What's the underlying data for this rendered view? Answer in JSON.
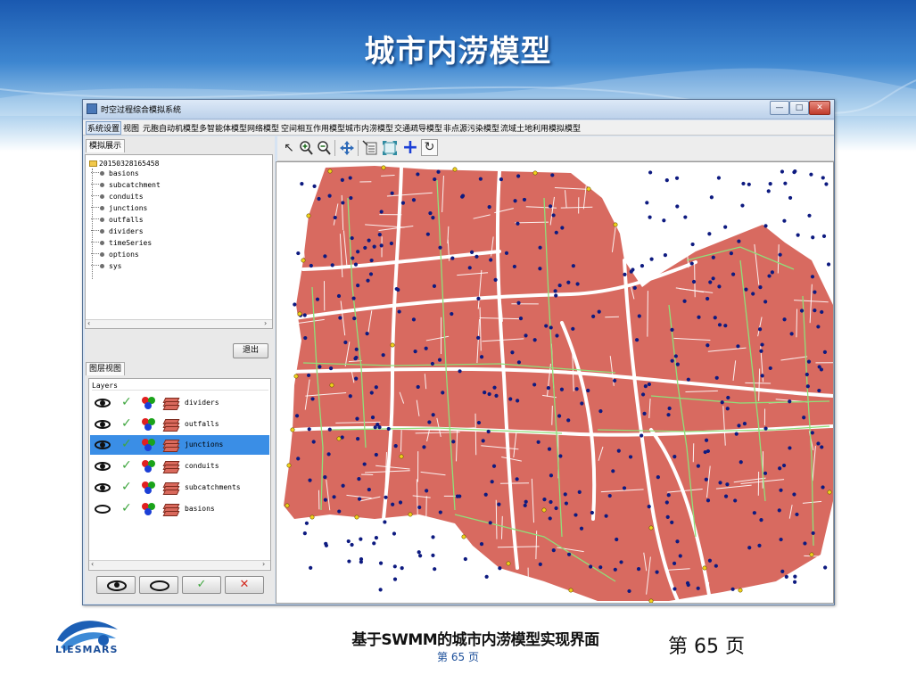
{
  "slide": {
    "title": "城市内涝模型",
    "caption": "基于SWMM的城市内涝模型实现界面",
    "page_small": "第  65 页",
    "page_big": "第 65 页",
    "logo_text": "LIESMARS",
    "colors": {
      "header_blue": "#1a59b0",
      "caption_blue": "#1c4f9a"
    }
  },
  "window": {
    "title": "时空过程综合模拟系统",
    "controls": {
      "minimize": "—",
      "maximize": "□",
      "close": "✕"
    }
  },
  "menu": [
    "系统设置",
    "视图",
    "元胞自动机模型",
    "多智能体模型",
    "网络模型",
    "空间相互作用模型",
    "城市内涝模型",
    "交通疏导模型",
    "非点源污染模型",
    "流域土地利用模拟模型"
  ],
  "left_panel": {
    "simulation_tab": "模拟展示",
    "tree": {
      "root": "20150328165458",
      "items": [
        "basions",
        "subcatchment",
        "conduits",
        "junctions",
        "outfalls",
        "dividers",
        "timeSeries",
        "options",
        "sys"
      ]
    },
    "exit_button": "退出",
    "layers_tab": "图层视图",
    "layers_header": "Layers",
    "layers": [
      {
        "name": "dividers",
        "visible": true,
        "selected": false
      },
      {
        "name": "outfalls",
        "visible": true,
        "selected": false
      },
      {
        "name": "junctions",
        "visible": true,
        "selected": true
      },
      {
        "name": "conduits",
        "visible": true,
        "selected": false
      },
      {
        "name": "subcatchments",
        "visible": true,
        "selected": false
      },
      {
        "name": "basions",
        "visible": false,
        "selected": false
      }
    ],
    "layer_buttons": [
      "show-all-icon",
      "hide-all-icon",
      "confirm-icon",
      "cancel-icon"
    ]
  },
  "map": {
    "toolbar": [
      "select-arrow-icon",
      "zoom-in-icon",
      "zoom-out-icon",
      "pan-icon",
      "layer-properties-icon",
      "full-extent-icon",
      "add-point-icon",
      "refresh-icon"
    ],
    "colors": {
      "subcatchment_fill": "#d86a60",
      "street": "#ffffff",
      "conduit": "#8fe07a",
      "junction": "#0d1a80",
      "outfall": "#f2d21c"
    }
  }
}
